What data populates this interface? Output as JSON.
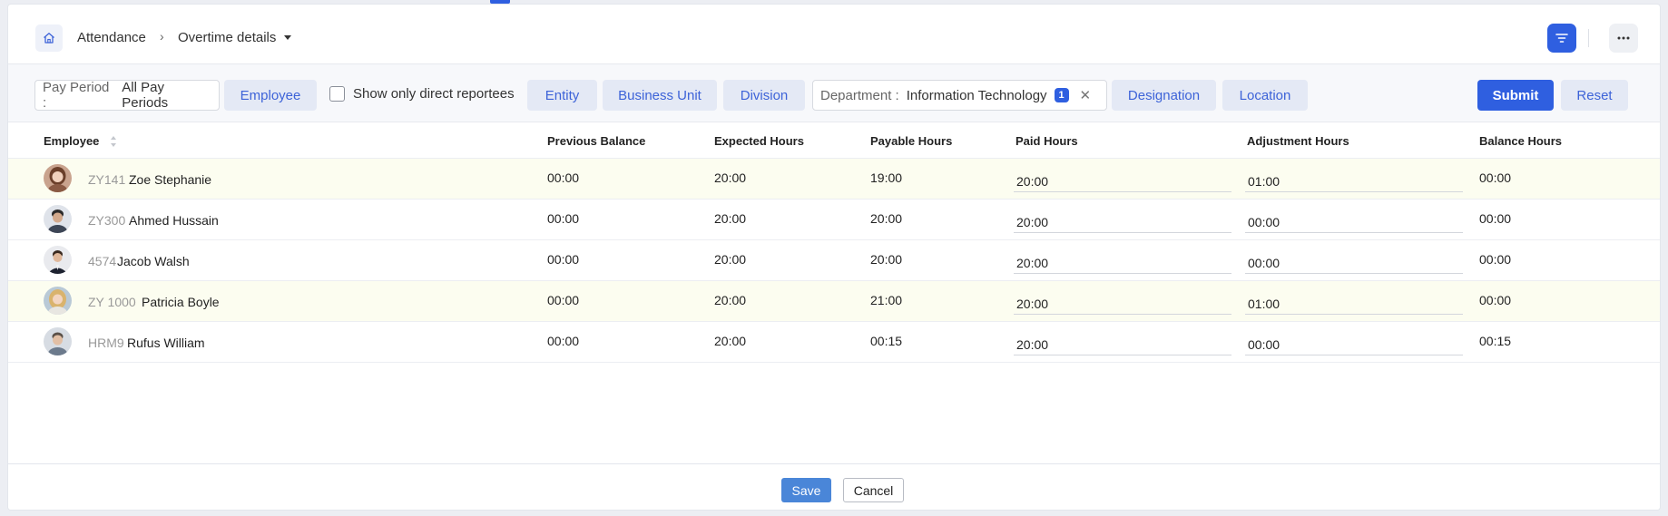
{
  "breadcrumb": {
    "items": [
      "Attendance",
      "Overtime details"
    ]
  },
  "filters": {
    "pay_period_label": "Pay Period :",
    "pay_period_value": "All Pay Periods",
    "employee": "Employee",
    "direct_reportees": "Show only direct reportees",
    "entity": "Entity",
    "business_unit": "Business Unit",
    "division": "Division",
    "department_label": "Department :",
    "department_value": "Information Technology",
    "department_count": "1",
    "designation": "Designation",
    "location": "Location",
    "submit": "Submit",
    "reset": "Reset"
  },
  "table": {
    "columns": [
      "Employee",
      "Previous Balance",
      "Expected Hours",
      "Payable Hours",
      "Paid Hours",
      "Adjustment Hours",
      "Balance Hours"
    ],
    "rows": [
      {
        "id": "ZY141",
        "name": "Zoe Stephanie",
        "previous": "00:00",
        "expected": "20:00",
        "payable": "19:00",
        "paid": "20:00",
        "adjustment": "01:00",
        "balance": "00:00",
        "highlighted": true
      },
      {
        "id": "ZY300",
        "name": "Ahmed Hussain",
        "previous": "00:00",
        "expected": "20:00",
        "payable": "20:00",
        "paid": "20:00",
        "adjustment": "00:00",
        "balance": "00:00",
        "highlighted": false
      },
      {
        "id": "4574",
        "name": "Jacob Walsh",
        "previous": "00:00",
        "expected": "20:00",
        "payable": "20:00",
        "paid": "20:00",
        "adjustment": "00:00",
        "balance": "00:00",
        "highlighted": false
      },
      {
        "id": "ZY 1000",
        "name": "Patricia Boyle",
        "previous": "00:00",
        "expected": "20:00",
        "payable": "21:00",
        "paid": "20:00",
        "adjustment": "01:00",
        "balance": "00:00",
        "highlighted": true
      },
      {
        "id": "HRM9",
        "name": "Rufus William",
        "previous": "00:00",
        "expected": "20:00",
        "payable": "00:15",
        "paid": "20:00",
        "adjustment": "00:00",
        "balance": "00:15",
        "highlighted": false
      }
    ]
  },
  "footer": {
    "save": "Save",
    "cancel": "Cancel"
  },
  "colors": {
    "primary": "#2f5fe0",
    "row_highlight": "#fcfdf0",
    "save": "#4a86d8"
  }
}
